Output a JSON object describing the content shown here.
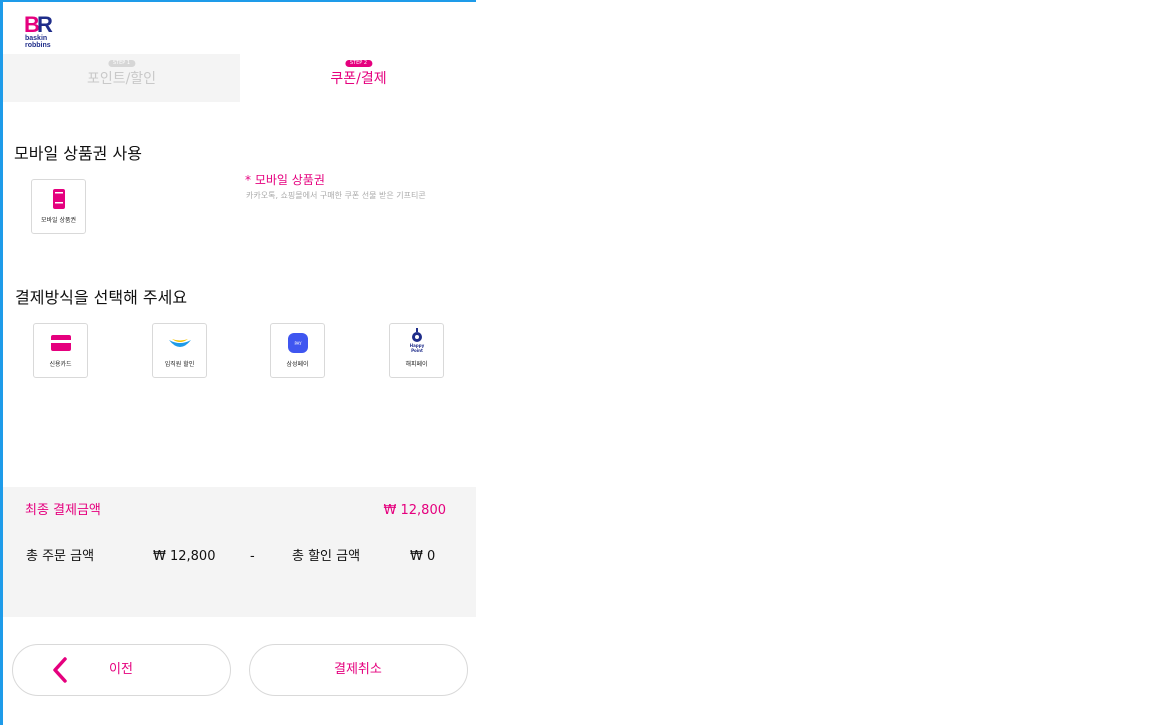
{
  "brand": {
    "logo_text": "baskin robbins",
    "accent": "#e5007e",
    "frame": "#1e9be9"
  },
  "tabs": [
    {
      "badge": "STEP 1",
      "label": "포인트/할인",
      "active": false
    },
    {
      "badge": "STEP 2",
      "label": "쿠폰/결제",
      "active": true
    }
  ],
  "voucher": {
    "title": "모바일 상품권 사용",
    "tile_label": "모바일 상품권",
    "note_title": "* 모바일 상품권",
    "note_desc": "카카오톡, 쇼핑몰에서 구매한 쿠폰 선물 받은 기프티콘"
  },
  "payment": {
    "title": "결제방식을 선택해 주세요",
    "methods": [
      {
        "label": "신용카드",
        "icon": "credit-card-icon"
      },
      {
        "label": "임직원 할인",
        "icon": "employee-discount-icon"
      },
      {
        "label": "삼성페이",
        "icon": "samsung-pay-icon"
      },
      {
        "label": "해피페이",
        "icon": "happy-point-icon"
      }
    ],
    "samsung_icon_text": "PAY",
    "happy_icon_text": "Happy Point"
  },
  "summary": {
    "final_label": "최종 결제금액",
    "final_amount": "₩ 12,800",
    "order_label": "총 주문 금액",
    "order_amount": "₩ 12,800",
    "minus": "-",
    "discount_label": "총 할인 금액",
    "discount_amount": "₩ 0"
  },
  "buttons": {
    "prev": "이전",
    "cancel": "결제취소"
  }
}
